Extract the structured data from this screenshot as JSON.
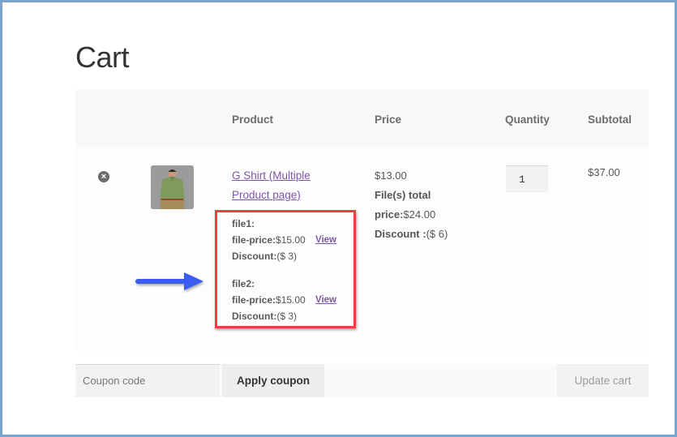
{
  "page": {
    "title": "Cart"
  },
  "table": {
    "headers": {
      "product": "Product",
      "price": "Price",
      "quantity": "Quantity",
      "subtotal": "Subtotal"
    },
    "rows": [
      {
        "remove_icon": "×",
        "product_name": "G Shirt (Multiple Product page)",
        "files": [
          {
            "label": "file1:",
            "price_label": "file-price:",
            "price": "$15.00",
            "view_label": "View",
            "discount_label": "Discount:",
            "discount": "($ 3)"
          },
          {
            "label": "file2:",
            "price_label": "file-price:",
            "price": "$15.00",
            "view_label": "View",
            "discount_label": "Discount:",
            "discount": "($ 3)"
          }
        ],
        "price": "$13.00",
        "files_total_label_1": "File(s) total",
        "files_total_label_2": "price:",
        "files_total_price": "$24.00",
        "discount_label": "Discount :",
        "discount": "($ 6)",
        "quantity": "1",
        "subtotal": "$37.00"
      }
    ]
  },
  "actions": {
    "coupon_placeholder": "Coupon code",
    "apply_coupon_label": "Apply coupon",
    "update_cart_label": "Update cart"
  },
  "annotation": {
    "arrow_color": "#3b5cf0",
    "highlight_color": "#ec4040"
  }
}
